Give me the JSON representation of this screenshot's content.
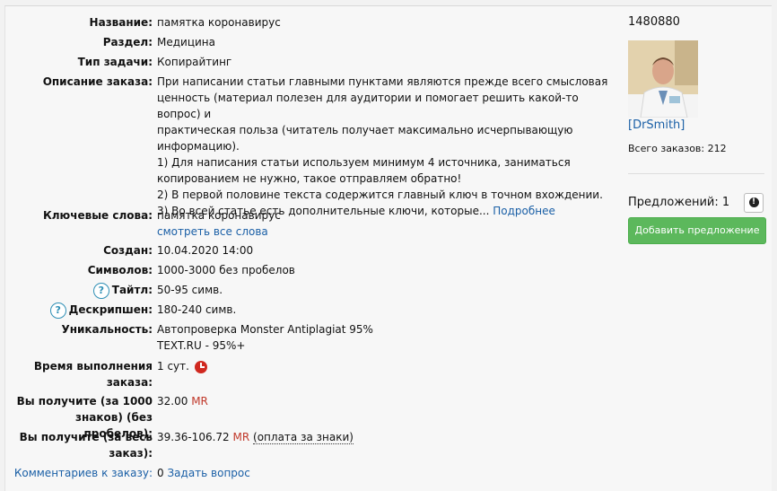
{
  "order": {
    "name_label": "Название:",
    "name_value": "памятка коронавирус",
    "section_label": "Раздел:",
    "section_value": "Медицина",
    "type_label": "Тип задачи:",
    "type_value": "Копирайтинг",
    "desc_label": "Описание заказа:",
    "desc_lines": [
      "При написании статьи главными пунктами являются прежде всего смысловая",
      "ценность (материал полезен для аудитории и помогает решить какой-то вопрос) и",
      "практическая польза (читатель получает максимально исчерпывающую",
      "информацию).",
      "1) Для написания статьи используем минимум 4 источника, заниматься",
      "копированием не нужно, такое отправляем обратно!",
      "2) В первой половине текста содержится главный ключ в точном вхождении.",
      "3) Во всей статье есть дополнительные ключи, которые..."
    ],
    "more_link": "Подробнее",
    "keywords_label": "Ключевые слова:",
    "keywords_value": "памятка коронавирус",
    "keywords_link": "смотреть все слова",
    "created_label": "Создан:",
    "created_value": "10.04.2020 14:00",
    "symbols_label": "Символов:",
    "symbols_value": "1000-3000 без пробелов",
    "title_label": "Тайтл:",
    "title_value": "50-95 симв.",
    "descr_label": "Дескрипшен:",
    "descr_value": "180-240 симв.",
    "uniq_label": "Уникальность:",
    "uniq_line1": "Автопроверка Monster Antiplagiat 95%",
    "uniq_line2": "TEXT.RU - 95%+",
    "time_label_1": "Время выполнения",
    "time_label_2": "заказа:",
    "time_value": "1 сут.",
    "per1000_label_1": "Вы получите (за 1000",
    "per1000_label_2": "знаков) (без пробелов):",
    "per1000_value": "32.00",
    "currency": "MR",
    "whole_label_1": "Вы получите (за весь",
    "whole_label_2": "заказ):",
    "whole_value": "39.36-106.72",
    "whole_note": "(оплата за знаки)",
    "comments_label": "Комментариев к заказу:",
    "comments_count": "0",
    "ask_link": "Задать вопрос",
    "help_glyph": "?"
  },
  "customer": {
    "order_id": "1480880",
    "username": "[DrSmith]",
    "total_orders": "Всего заказов: 212",
    "offers": "Предложений: 1",
    "offers_icon_glyph": "!",
    "add_offer_button": "Добавить предложение"
  },
  "colors": {
    "link": "#1a5fa6",
    "currency": "#c0392b",
    "button": "#5cb85c"
  }
}
